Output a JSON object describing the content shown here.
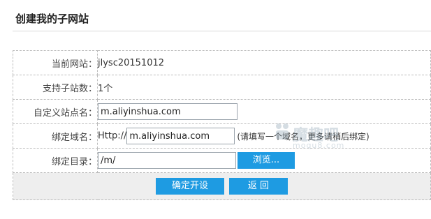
{
  "page": {
    "title": "创建我的子网站"
  },
  "form": {
    "current_site": {
      "label": "当前网站：",
      "value": "jlysc20151012"
    },
    "subsite_count": {
      "label": "支持子站数：",
      "value": "1个"
    },
    "site_name": {
      "label": "自定义站点名：",
      "value": "m.aliyinshua.com"
    },
    "bind_domain": {
      "label": "绑定域名：",
      "prefix": "Http://",
      "value": "m.aliyinshua.com",
      "hint": "(请填写一个域名，更多请稍后绑定)"
    },
    "bind_dir": {
      "label": "绑定目录：",
      "value": "/m/",
      "browse_label": "浏览..."
    }
  },
  "actions": {
    "submit_label": "确定开设",
    "back_label": "返 回"
  },
  "watermark": {
    "text": "魔趣吧",
    "sub": "moqu8.com"
  },
  "colors": {
    "accent": "#1e9be2",
    "action_bar": "#eeeeee",
    "border": "#bcbcbc"
  }
}
